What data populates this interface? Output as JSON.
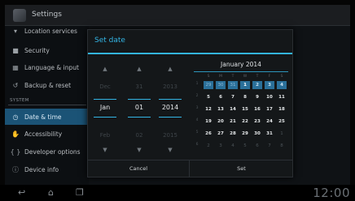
{
  "app": {
    "title": "Settings"
  },
  "sidebar": {
    "items": [
      {
        "label": "Location services",
        "icon": "location-icon"
      },
      {
        "label": "Security",
        "icon": "lock-icon"
      },
      {
        "label": "Language & input",
        "icon": "keyboard-icon"
      },
      {
        "label": "Backup & reset",
        "icon": "restore-icon"
      },
      {
        "label": "Date & time",
        "icon": "clock-icon",
        "selected": true
      },
      {
        "label": "Accessibility",
        "icon": "hand-icon"
      },
      {
        "label": "Developer options",
        "icon": "braces-icon"
      },
      {
        "label": "Device info",
        "icon": "info-icon"
      }
    ],
    "section_header": "SYSTEM"
  },
  "dialog": {
    "title": "Set date",
    "spinners": [
      {
        "name": "month",
        "prev": "Dec",
        "current": "Jan",
        "next": "Feb"
      },
      {
        "name": "day",
        "prev": "31",
        "current": "01",
        "next": "02"
      },
      {
        "name": "year",
        "prev": "2013",
        "current": "2014",
        "next": "2015"
      }
    ],
    "calendar": {
      "month_label": "January 2014",
      "weekdays": [
        "S",
        "M",
        "T",
        "W",
        "T",
        "F",
        "S"
      ],
      "weeks": [
        {
          "num": "1",
          "days": [
            {
              "d": "29",
              "other": true,
              "hl": true
            },
            {
              "d": "30",
              "other": true,
              "hl": true
            },
            {
              "d": "31",
              "other": true,
              "hl": true
            },
            {
              "d": "1",
              "sel": true
            },
            {
              "d": "2",
              "hl": true
            },
            {
              "d": "3",
              "hl": true
            },
            {
              "d": "4",
              "hl": true
            }
          ]
        },
        {
          "num": "2",
          "days": [
            {
              "d": "5"
            },
            {
              "d": "6"
            },
            {
              "d": "7"
            },
            {
              "d": "8"
            },
            {
              "d": "9"
            },
            {
              "d": "10"
            },
            {
              "d": "11"
            }
          ]
        },
        {
          "num": "3",
          "days": [
            {
              "d": "12"
            },
            {
              "d": "13"
            },
            {
              "d": "14"
            },
            {
              "d": "15"
            },
            {
              "d": "16"
            },
            {
              "d": "17"
            },
            {
              "d": "18"
            }
          ]
        },
        {
          "num": "4",
          "days": [
            {
              "d": "19"
            },
            {
              "d": "20"
            },
            {
              "d": "21"
            },
            {
              "d": "22"
            },
            {
              "d": "23"
            },
            {
              "d": "24"
            },
            {
              "d": "25"
            }
          ]
        },
        {
          "num": "5",
          "days": [
            {
              "d": "26"
            },
            {
              "d": "27"
            },
            {
              "d": "28"
            },
            {
              "d": "29"
            },
            {
              "d": "30"
            },
            {
              "d": "31"
            },
            {
              "d": "1",
              "other": true
            }
          ]
        },
        {
          "num": "6",
          "days": [
            {
              "d": "2",
              "other": true
            },
            {
              "d": "3",
              "other": true
            },
            {
              "d": "4",
              "other": true
            },
            {
              "d": "5",
              "other": true
            },
            {
              "d": "6",
              "other": true
            },
            {
              "d": "7",
              "other": true
            },
            {
              "d": "8",
              "other": true
            }
          ]
        }
      ]
    },
    "buttons": {
      "cancel": "Cancel",
      "set": "Set"
    }
  },
  "navbar": {
    "clock": "12:00"
  },
  "colors": {
    "accent": "#33b5e5",
    "selected_row": "#1b5376",
    "calendar_highlight": "#2a6f99"
  }
}
